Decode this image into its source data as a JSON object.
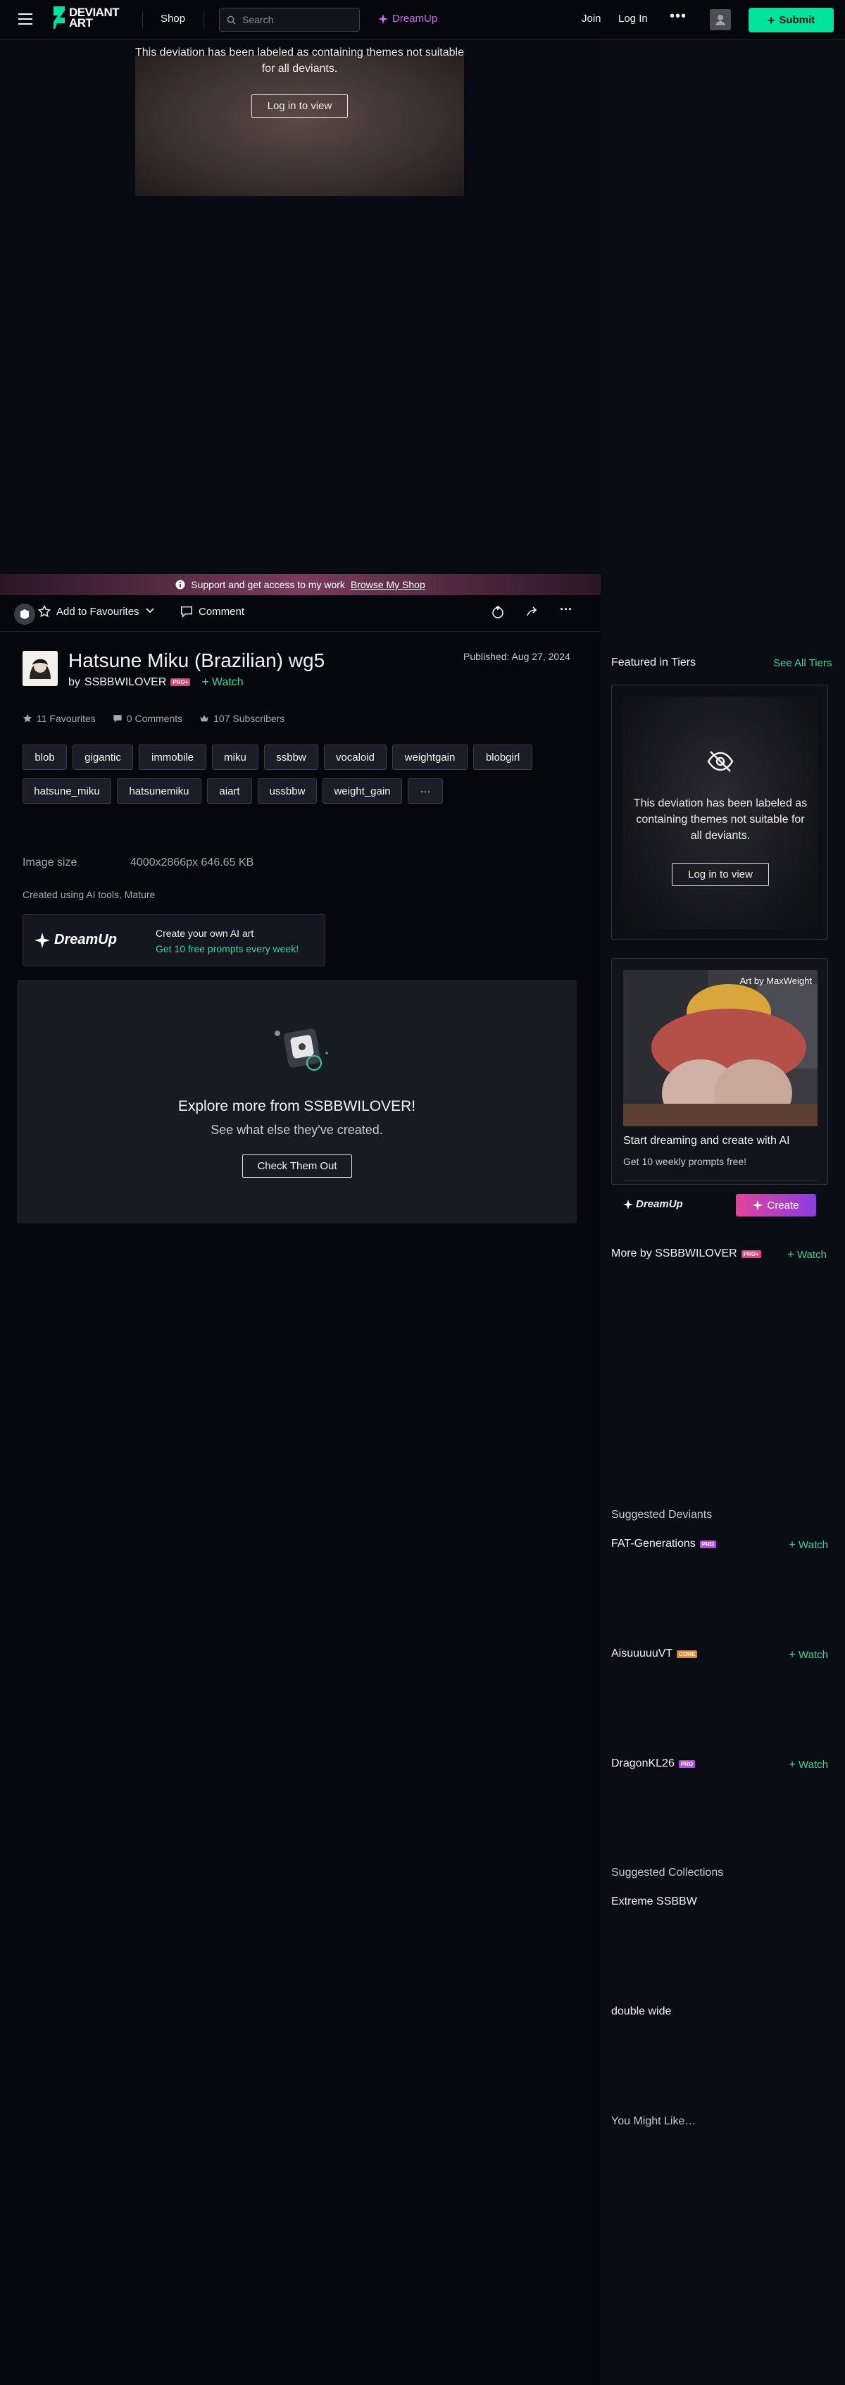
{
  "header": {
    "logo_line1": "DEVIANT",
    "logo_line2": "ART",
    "shop": "Shop",
    "search_placeholder": "Search",
    "dreamup": "DreamUp",
    "join": "Join",
    "login": "Log In",
    "more": "•••",
    "submit": "Submit"
  },
  "artwork": {
    "mature_text": "This deviation has been labeled as containing themes not suitable for all deviants.",
    "login_to_view": "Log in to view"
  },
  "support_bar": {
    "text": "Support and get access to my work",
    "link": "Browse My Shop"
  },
  "actions": {
    "favourite": "Add to Favourites",
    "comment": "Comment"
  },
  "deviation": {
    "title": "Hatsune Miku (Brazilian) wg5",
    "by": "by",
    "author": "SSBBWILOVER",
    "author_badge": "PRO+",
    "watch": "Watch",
    "published": "Published: Aug 27, 2024",
    "favourites": "11 Favourites",
    "comments": "0 Comments",
    "subscribers": "107 Subscribers",
    "tags": [
      "blob",
      "gigantic",
      "immobile",
      "miku",
      "ssbbw",
      "vocaloid",
      "weightgain",
      "blobgirl",
      "hatsune_miku",
      "hatsunemiku",
      "aiart",
      "ussbbw",
      "weight_gain",
      "···"
    ],
    "image_size_label": "Image size",
    "image_size_value": "4000x2866px 646.65 KB",
    "created": "Created using AI tools, Mature"
  },
  "dreamup_box": {
    "logo": "DreamUp",
    "line1": "Create your own AI art",
    "line2": "Get 10 free prompts every week!"
  },
  "explore": {
    "title": "Explore more from SSBBWILOVER!",
    "subtitle": "See what else they've created.",
    "button": "Check Them Out"
  },
  "sidebar": {
    "featured_title": "Featured in Tiers",
    "see_all": "See All Tiers",
    "tier_mature_text": "This deviation has been labeled as containing themes not suitable for all deviants.",
    "tier_login": "Log in to view",
    "du_credit": "Art by MaxWeight",
    "du_title": "Start dreaming and create with AI",
    "du_sub": "Get 10 weekly prompts free!",
    "du_logo": "DreamUp",
    "du_create": "Create",
    "more_by": "More by SSBBWILOVER",
    "more_by_badge": "PRO+",
    "watch": "Watch",
    "suggested_deviants_title": "Suggested Deviants",
    "suggested_deviants": [
      {
        "name": "FAT-Generations",
        "badge": "PRO",
        "badge_color": "#b44dea"
      },
      {
        "name": "AisuuuuuVT",
        "badge": "CORE",
        "badge_color": "#e8842c"
      },
      {
        "name": "DragonKL26",
        "badge": "PRO",
        "badge_color": "#b44dea"
      }
    ],
    "suggested_collections_title": "Suggested Collections",
    "collections": [
      "Extreme SSBBW",
      "double wide"
    ],
    "you_might_like": "You Might Like…"
  },
  "colors": {
    "background": "#06070d",
    "accent_green": "#00e59b",
    "watch_green": "#40d29a",
    "dreamup_purple": "#c86ef0"
  }
}
